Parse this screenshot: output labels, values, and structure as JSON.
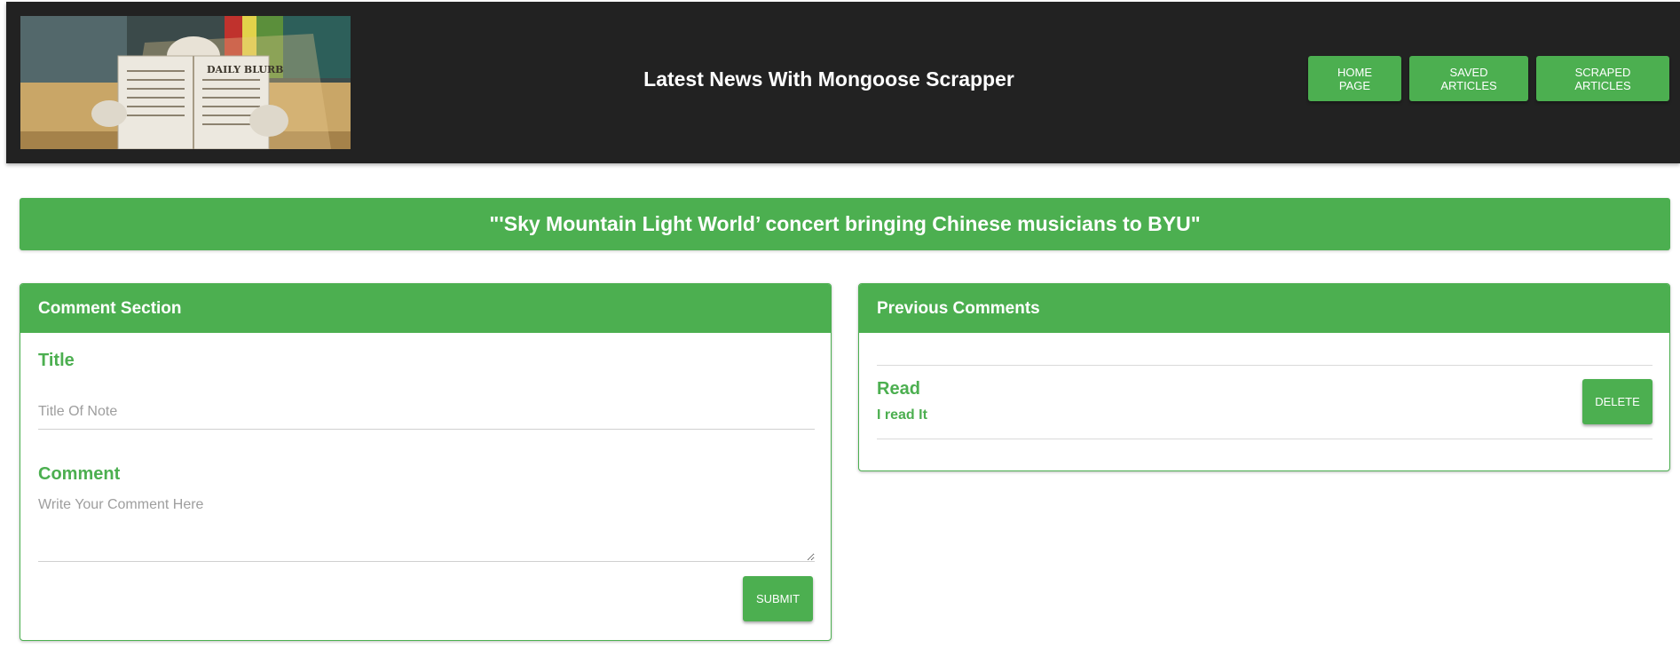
{
  "header": {
    "site_title": "Latest News With Mongoose Scrapper",
    "newspaper_masthead": "DAILY BLURB",
    "nav": [
      {
        "label": "HOME PAGE"
      },
      {
        "label": "SAVED ARTICLES"
      },
      {
        "label": "SCRAPED ARTICLES"
      }
    ]
  },
  "article": {
    "title": "\"'Sky Mountain Light World’ concert bringing Chinese musicians to BYU\""
  },
  "comment_section": {
    "heading": "Comment Section",
    "title_label": "Title",
    "title_placeholder": "Title Of Note",
    "comment_label": "Comment",
    "comment_placeholder": "Write Your Comment Here",
    "submit_label": "SUBMIT"
  },
  "previous_comments": {
    "heading": "Previous Comments",
    "items": [
      {
        "title": "Read",
        "body": "I read It",
        "delete_label": "DELETE"
      }
    ]
  },
  "colors": {
    "accent": "#4caf50",
    "header_bg": "#222222"
  }
}
